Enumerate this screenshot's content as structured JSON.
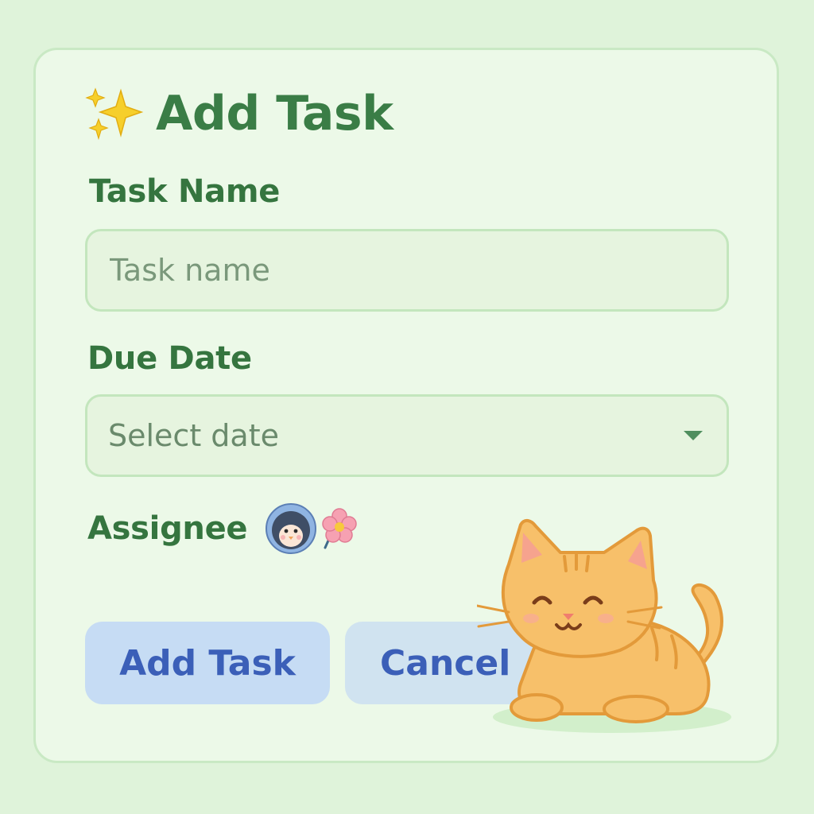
{
  "dialog": {
    "title": "Add Task",
    "title_icon": "sparkles-icon"
  },
  "fields": {
    "task_name": {
      "label": "Task Name",
      "placeholder": "Task name",
      "value": ""
    },
    "due_date": {
      "label": "Due Date",
      "placeholder": "Select date",
      "icon": "chevron-down-icon"
    },
    "assignee": {
      "label": "Assignee",
      "avatar_icon": "penguin-avatar-icon",
      "decoration_icon": "flower-icon"
    }
  },
  "buttons": {
    "add_label": "Add Task",
    "cancel_label": "Cancel"
  },
  "decoration": {
    "mascot": "cat-mascot-icon"
  },
  "colors": {
    "background": "#dff3da",
    "card": "#ecf9e8",
    "heading": "#3a7d46",
    "button_text": "#3b5fb8",
    "button_add": "#c6dcf4",
    "button_cancel": "#d0e3f0",
    "cat": "#f7c06a"
  }
}
